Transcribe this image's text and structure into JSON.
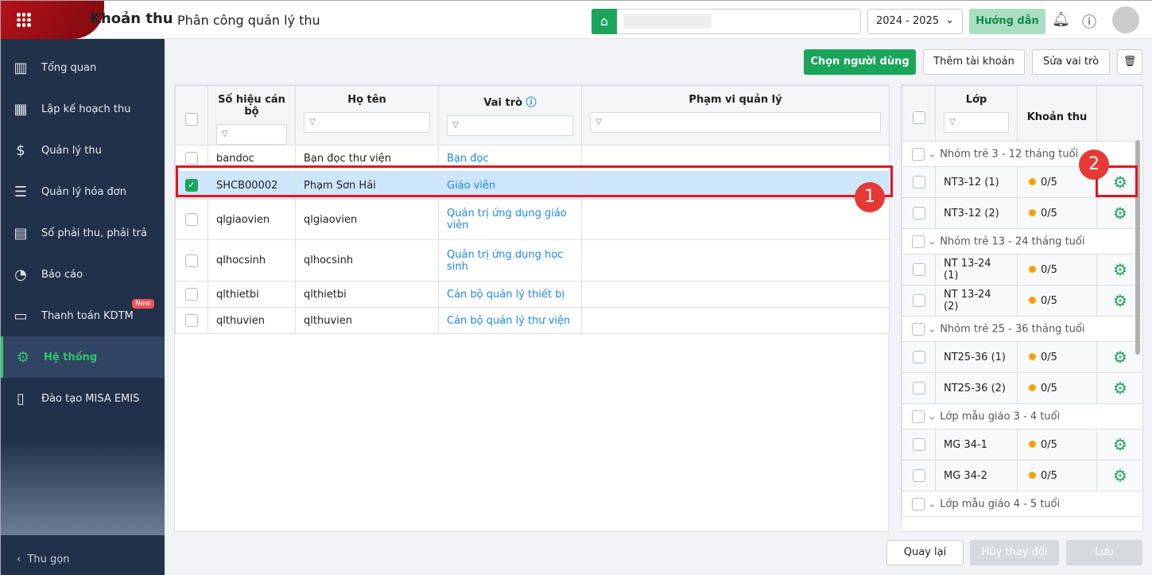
{
  "header": {
    "app_name": "Khoản thu",
    "page_title": "Phân công quản lý thu",
    "school_year": "2024 - 2025",
    "guide_label": "Hướng dẫn"
  },
  "sidebar": {
    "items": [
      {
        "label": "Tổng quan",
        "icon": "chart-icon"
      },
      {
        "label": "Lập kế hoạch thu",
        "icon": "calendar-icon"
      },
      {
        "label": "Quản lý thu",
        "icon": "money-hand-icon"
      },
      {
        "label": "Quản lý hóa đơn",
        "icon": "document-icon"
      },
      {
        "label": "Sổ phải thu, phải trả",
        "icon": "book-icon"
      },
      {
        "label": "Báo cáo",
        "icon": "pie-chart-icon"
      },
      {
        "label": "Thanh toán KDTM",
        "icon": "card-icon",
        "badge": "New"
      },
      {
        "label": "Hệ thống",
        "icon": "gear-icon",
        "active": true
      },
      {
        "label": "Đào tạo MISA EMIS",
        "icon": "open-book-icon"
      }
    ],
    "collapse_label": "Thu gọn"
  },
  "toolbar": {
    "choose_user": "Chọn người dùng",
    "add_account": "Thêm tài khoản",
    "edit_role": "Sửa vai trò"
  },
  "users_table": {
    "columns": [
      "Số hiệu cán bộ",
      "Họ tên",
      "Vai trò",
      "Phạm vi quản lý"
    ],
    "rows": [
      {
        "id": "bandoc",
        "name": "Bạn đọc thư viện",
        "role": "Bạn đọc",
        "checked": false
      },
      {
        "id": "SHCB00002",
        "name": "Phạm Sơn Hải",
        "role": "Giáo viên",
        "checked": true
      },
      {
        "id": "qlgiaovien",
        "name": "qlgiaovien",
        "role": "Quản trị ứng dụng giáo viên",
        "checked": false
      },
      {
        "id": "qlhocsinh",
        "name": "qlhocsinh",
        "role": "Quản trị ứng dụng học sinh",
        "checked": false
      },
      {
        "id": "qlthietbi",
        "name": "qlthietbi",
        "role": "Cán bộ quản lý thiết bị",
        "checked": false
      },
      {
        "id": "qlthuvien",
        "name": "qlthuvien",
        "role": "Cán bộ quản lý thư viện",
        "checked": false
      }
    ]
  },
  "class_table": {
    "columns": [
      "Lớp",
      "Khoản thu"
    ],
    "groups": [
      {
        "name": "Nhóm trẻ 3 - 12 tháng tuổi",
        "items": [
          {
            "cls": "NT3-12 (1)",
            "fees": "0/5"
          },
          {
            "cls": "NT3-12 (2)",
            "fees": "0/5"
          }
        ]
      },
      {
        "name": "Nhóm trẻ 13 - 24 tháng tuổi",
        "items": [
          {
            "cls": "NT 13-24 (1)",
            "fees": "0/5"
          },
          {
            "cls": "NT 13-24 (2)",
            "fees": "0/5"
          }
        ]
      },
      {
        "name": "Nhóm trẻ 25 - 36 tháng tuổi",
        "items": [
          {
            "cls": "NT25-36 (1)",
            "fees": "0/5"
          },
          {
            "cls": "NT25-36 (2)",
            "fees": "0/5"
          }
        ]
      },
      {
        "name": "Lớp mẫu giáo 3 - 4 tuổi",
        "items": [
          {
            "cls": "MG 34-1",
            "fees": "0/5"
          },
          {
            "cls": "MG 34-2",
            "fees": "0/5"
          }
        ]
      },
      {
        "name": "Lớp mẫu giáo 4 - 5 tuổi",
        "items": []
      }
    ]
  },
  "footer": {
    "back": "Quay lại",
    "cancel": "Hủy thay đổi",
    "save": "Lưu"
  },
  "callouts": [
    "1",
    "2"
  ],
  "colors": {
    "accent": "#1aa55a",
    "sidebar": "#22314a",
    "highlight": "#e0161e"
  }
}
